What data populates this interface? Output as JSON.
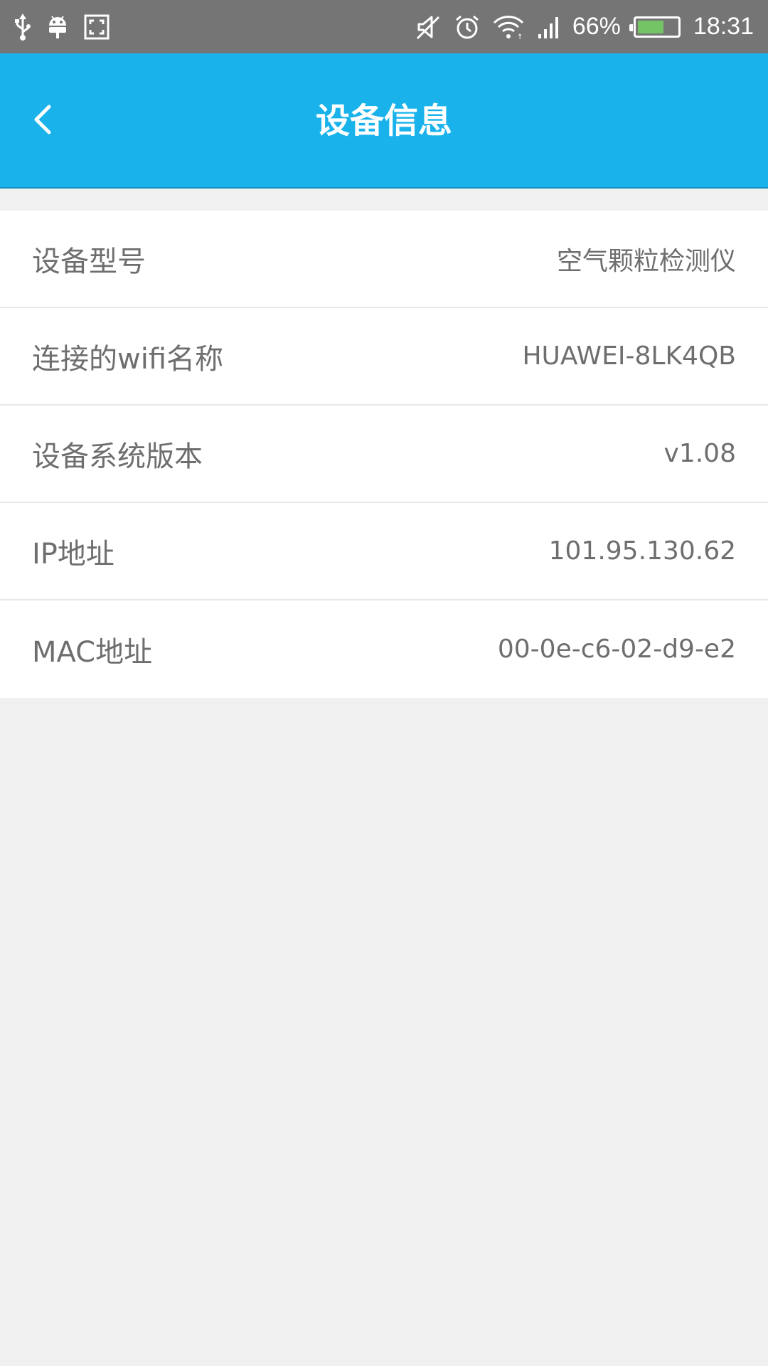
{
  "status_bar": {
    "left_icons": [
      "usb-icon",
      "android-icon",
      "screenshot-icon"
    ],
    "right_icons": [
      "mute-icon",
      "alarm-icon",
      "wifi-icon",
      "signal-icon"
    ],
    "battery_percent_text": "66%",
    "battery_level": 0.66,
    "battery_color": "#74c365",
    "time": "18:31"
  },
  "app_bar": {
    "title": "设备信息",
    "back_icon": "chevron-left-icon",
    "background_color": "#19b2eb"
  },
  "info": {
    "rows": [
      {
        "label": "设备型号",
        "value": "空气颗粒检测仪"
      },
      {
        "label": "连接的wifi名称",
        "value": "HUAWEI-8LK4QB"
      },
      {
        "label": "设备系统版本",
        "value": "v1.08"
      },
      {
        "label": "IP地址",
        "value": "101.95.130.62"
      },
      {
        "label": "MAC地址",
        "value": "00-0e-c6-02-d9-e2"
      }
    ]
  }
}
